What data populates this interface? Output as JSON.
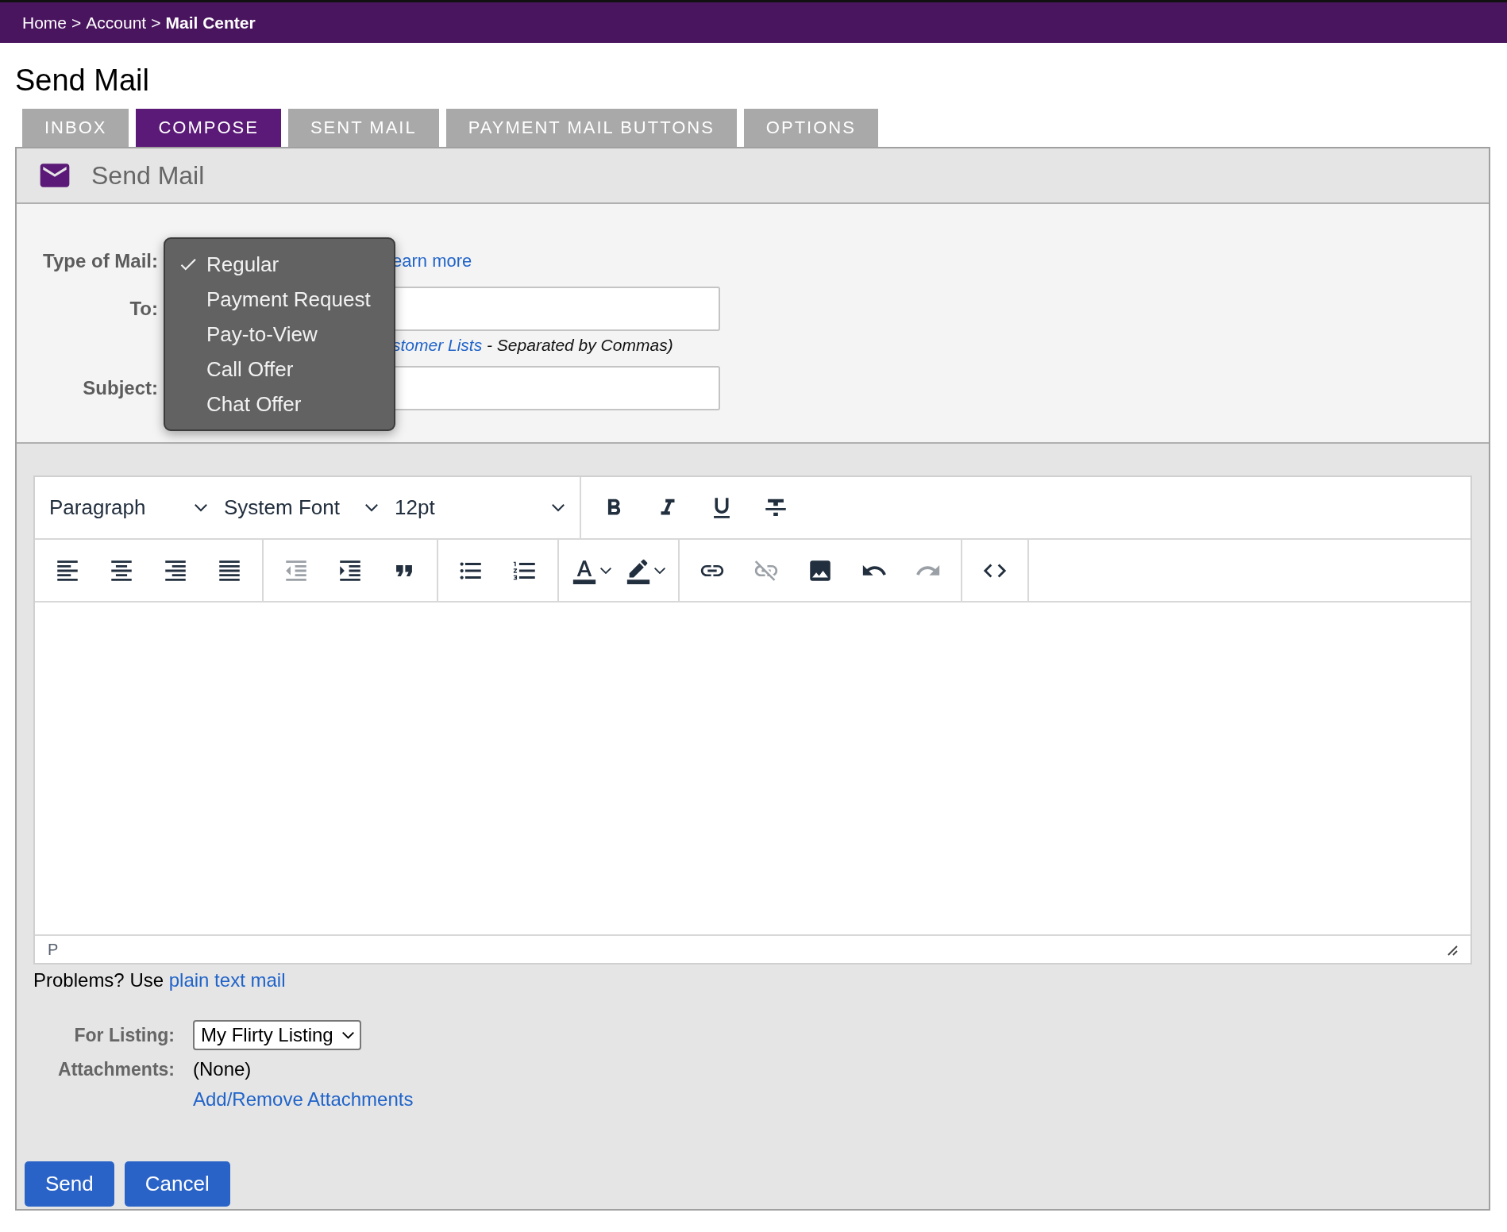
{
  "breadcrumb": {
    "separator": ">",
    "items": [
      {
        "label": "Home",
        "current": false
      },
      {
        "label": "Account",
        "current": false
      },
      {
        "label": "Mail Center",
        "current": true
      }
    ]
  },
  "page_title": "Send Mail",
  "tabs": [
    {
      "label": "INBOX",
      "selected": false
    },
    {
      "label": "COMPOSE",
      "selected": true
    },
    {
      "label": "SENT MAIL",
      "selected": false
    },
    {
      "label": "PAYMENT MAIL BUTTONS",
      "selected": false
    },
    {
      "label": "OPTIONS",
      "selected": false
    }
  ],
  "panel": {
    "title": "Send Mail"
  },
  "form": {
    "type_of_mail": {
      "label": "Type of Mail:",
      "learn_more": "earn more",
      "options": [
        {
          "label": "Regular",
          "selected": true
        },
        {
          "label": "Payment Request",
          "selected": false
        },
        {
          "label": "Pay-to-View",
          "selected": false
        },
        {
          "label": "Call Offer",
          "selected": false
        },
        {
          "label": "Chat Offer",
          "selected": false
        }
      ]
    },
    "to": {
      "label": "To:",
      "hint_link": "stomer Lists",
      "hint_text": " - Separated by Commas)"
    },
    "subject": {
      "label": "Subject:"
    }
  },
  "editor": {
    "selects": [
      {
        "value": "Paragraph"
      },
      {
        "value": "System Font"
      },
      {
        "value": "12pt"
      }
    ],
    "format_buttons": [
      {
        "kind": "bold",
        "disabled": false
      },
      {
        "kind": "italic",
        "disabled": false
      },
      {
        "kind": "underline",
        "disabled": false
      },
      {
        "kind": "strikethrough",
        "disabled": false
      }
    ],
    "groups": [
      [
        {
          "kind": "align-left",
          "disabled": false
        },
        {
          "kind": "align-center",
          "disabled": false
        },
        {
          "kind": "align-right",
          "disabled": false
        },
        {
          "kind": "align-justify",
          "disabled": false
        }
      ],
      [
        {
          "kind": "outdent",
          "disabled": true
        },
        {
          "kind": "indent",
          "disabled": false
        },
        {
          "kind": "quote",
          "disabled": false
        }
      ],
      [
        {
          "kind": "bullet-list",
          "disabled": false
        },
        {
          "kind": "numbered-list",
          "disabled": false
        }
      ],
      [
        {
          "kind": "text-color",
          "disabled": false,
          "has_menu": true
        },
        {
          "kind": "highlight",
          "disabled": false,
          "has_menu": true
        }
      ],
      [
        {
          "kind": "link",
          "disabled": false
        },
        {
          "kind": "unlink",
          "disabled": true
        },
        {
          "kind": "image",
          "disabled": false
        },
        {
          "kind": "undo",
          "disabled": false
        },
        {
          "kind": "redo",
          "disabled": true
        }
      ],
      [
        {
          "kind": "code",
          "disabled": false
        }
      ]
    ],
    "status_path": "P"
  },
  "problems": {
    "text": "Problems? Use",
    "link": "plain text mail"
  },
  "listing": {
    "label": "For Listing:",
    "value": "My Flirty Listing"
  },
  "attachments": {
    "label": "Attachments:",
    "value": "(None)",
    "link": "Add/Remove Attachments"
  },
  "buttons": [
    "Send",
    "Cancel"
  ]
}
